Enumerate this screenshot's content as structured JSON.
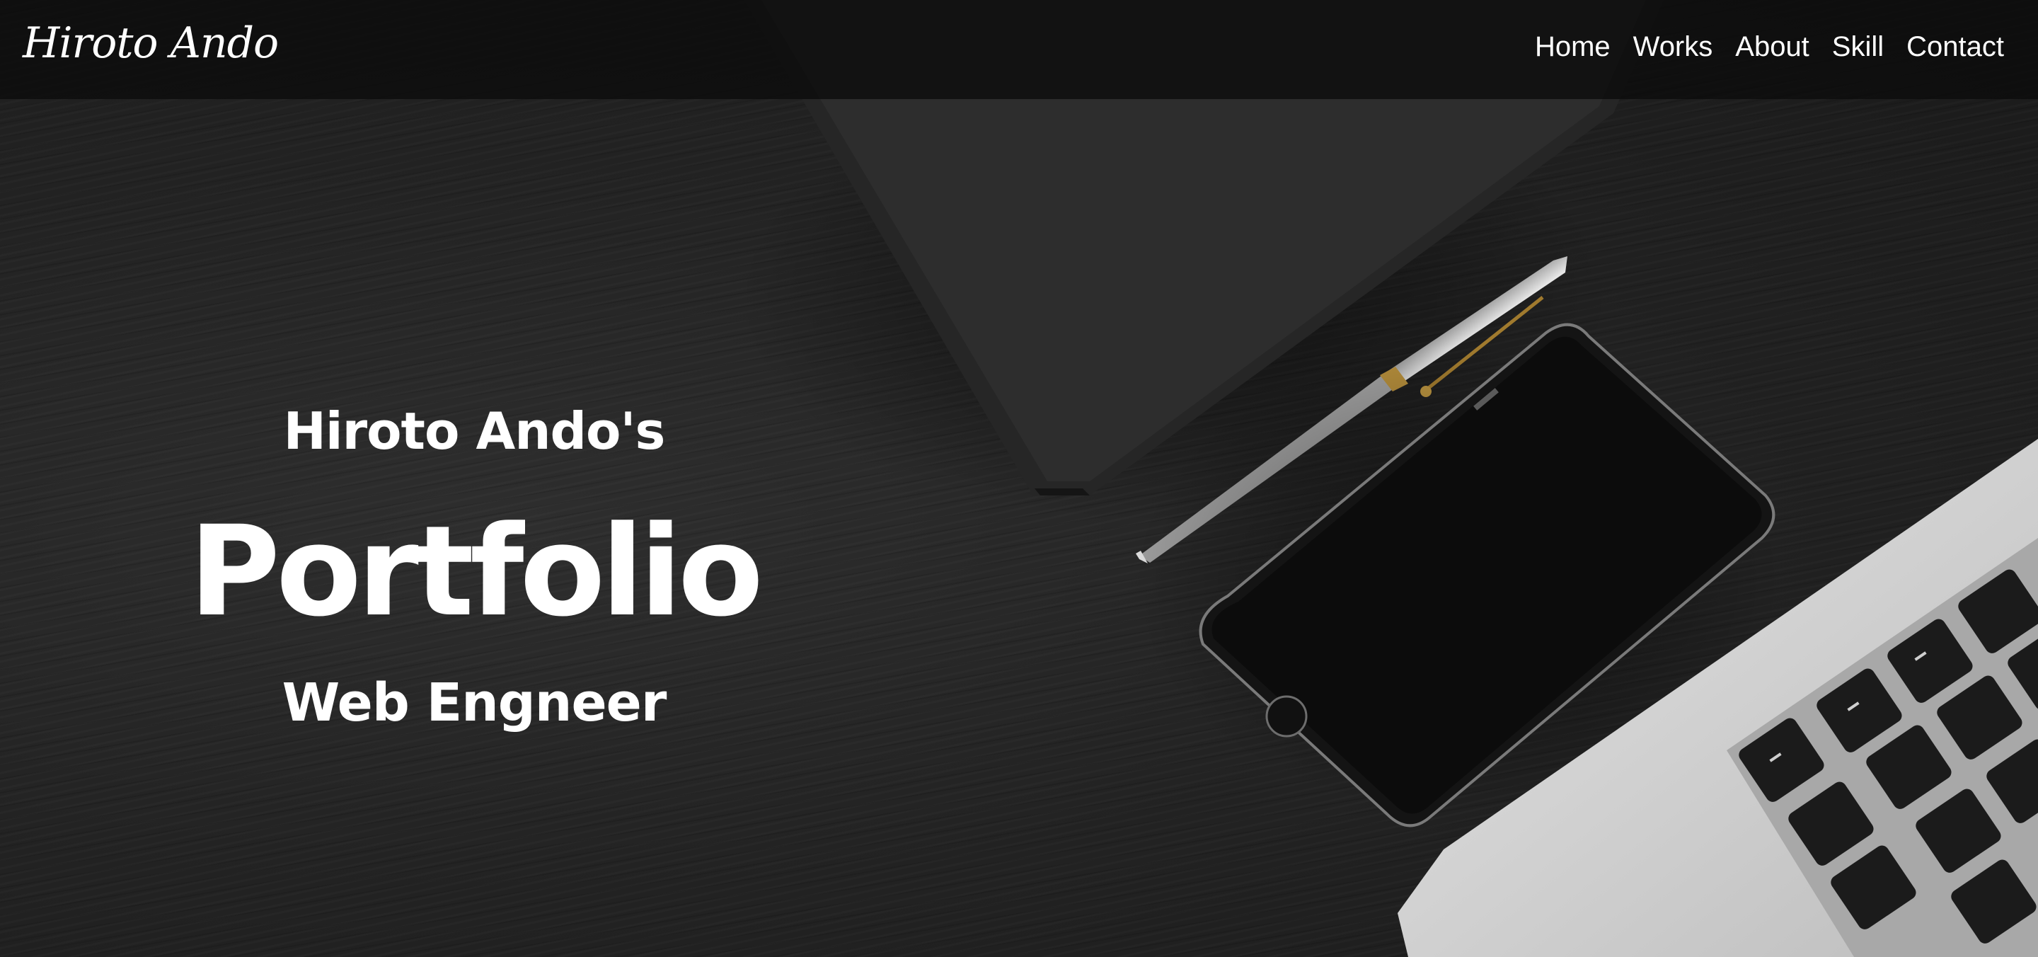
{
  "header": {
    "logo": "Hiroto Ando",
    "nav": [
      {
        "label": "Home"
      },
      {
        "label": "Works"
      },
      {
        "label": "About"
      },
      {
        "label": "Skill"
      },
      {
        "label": "Contact"
      }
    ]
  },
  "hero": {
    "owner": "Hiroto Ando's",
    "title": "Portfolio",
    "role": "Web Engneer",
    "background_description_icons": [
      "notebook-icon",
      "pen-icon",
      "smartphone-icon",
      "laptop-icon"
    ]
  },
  "colors": {
    "navbar_bg": "#0c0c0c",
    "text": "#ffffff",
    "desk": "#1c1c1c"
  }
}
